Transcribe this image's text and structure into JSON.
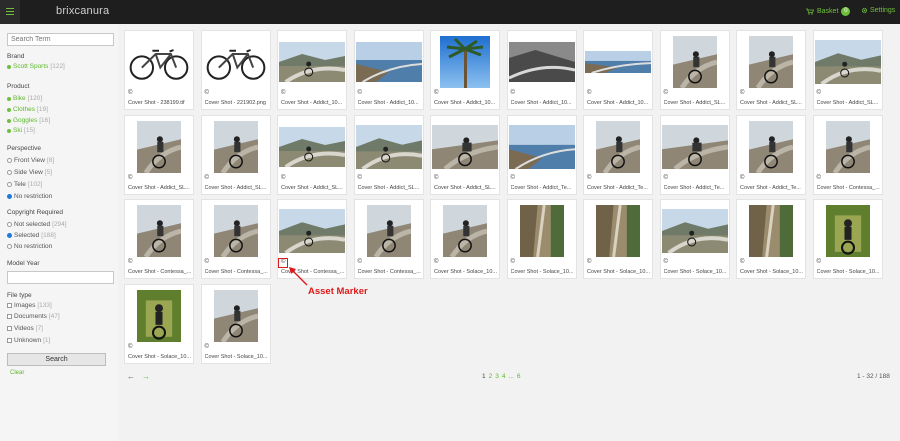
{
  "header": {
    "app_title": "brixcanura",
    "basket_label": "Basket",
    "basket_count": "0",
    "settings_label": "Settings"
  },
  "sidebar": {
    "search_placeholder": "Search Term",
    "brand_title": "Brand",
    "brand_items": [
      {
        "label": "Scott Sports",
        "count": "[122]"
      }
    ],
    "product_title": "Product",
    "product_items": [
      {
        "label": "Bike",
        "count": "[120]"
      },
      {
        "label": "Clothes",
        "count": "[19]"
      },
      {
        "label": "Goggles",
        "count": "[16]"
      },
      {
        "label": "Ski",
        "count": "[15]"
      }
    ],
    "perspective_title": "Perspective",
    "perspective_items": [
      {
        "label": "Front View",
        "count": "[8]",
        "selected": false
      },
      {
        "label": "Side View",
        "count": "[5]",
        "selected": false
      },
      {
        "label": "Tele",
        "count": "[102]",
        "selected": false
      },
      {
        "label": "No restriction",
        "count": "",
        "selected": true
      }
    ],
    "copyright_title": "Copyright Required",
    "copyright_items": [
      {
        "label": "Not selected",
        "count": "[294]",
        "selected": false
      },
      {
        "label": "Selected",
        "count": "[188]",
        "selected": true
      },
      {
        "label": "No restriction",
        "count": "",
        "selected": false
      }
    ],
    "model_year_title": "Model Year",
    "filetype_title": "File type",
    "filetype_items": [
      {
        "label": "Images",
        "count": "[133]"
      },
      {
        "label": "Documents",
        "count": "[47]"
      },
      {
        "label": "Videos",
        "count": "[7]"
      },
      {
        "label": "Unknown",
        "count": "[1]"
      }
    ],
    "search_button": "Search",
    "clear_link": "Clear"
  },
  "assets": [
    {
      "caption": "Cover Shot - 238199.tif",
      "kind": "bike",
      "w": 66,
      "h": 40
    },
    {
      "caption": "Cover Shot - 221902.png",
      "kind": "bike",
      "w": 66,
      "h": 40
    },
    {
      "caption": "Cover Shot - Addict_10...",
      "kind": "road",
      "w": 66,
      "h": 40
    },
    {
      "caption": "Cover Shot - Addict_10...",
      "kind": "sea",
      "w": 66,
      "h": 40
    },
    {
      "caption": "Cover Shot - Addict_10...",
      "kind": "palm",
      "w": 50,
      "h": 66
    },
    {
      "caption": "Cover Shot - Addict_10...",
      "kind": "bw",
      "w": 66,
      "h": 40
    },
    {
      "caption": "Cover Shot - Addict_10...",
      "kind": "sea",
      "w": 66,
      "h": 22
    },
    {
      "caption": "Cover Shot - Addict_SL...",
      "kind": "rider",
      "w": 44,
      "h": 66
    },
    {
      "caption": "Cover Shot - Addict_SL...",
      "kind": "rider",
      "w": 44,
      "h": 66
    },
    {
      "caption": "Cover Shot - Addict_SL...",
      "kind": "road",
      "w": 66,
      "h": 44
    },
    {
      "caption": "Cover Shot - Addict_SL...",
      "kind": "rider",
      "w": 44,
      "h": 66
    },
    {
      "caption": "Cover Shot - Addict_SL...",
      "kind": "rider",
      "w": 44,
      "h": 66
    },
    {
      "caption": "Cover Shot - Addict_SL...",
      "kind": "road",
      "w": 66,
      "h": 40
    },
    {
      "caption": "Cover Shot - Addict_SL...",
      "kind": "road",
      "w": 66,
      "h": 44
    },
    {
      "caption": "Cover Shot - Addict_SL...",
      "kind": "rider",
      "w": 66,
      "h": 44
    },
    {
      "caption": "Cover Shot - Addict_Te...",
      "kind": "sea",
      "w": 66,
      "h": 44
    },
    {
      "caption": "Cover Shot - Addict_Te...",
      "kind": "rider",
      "w": 44,
      "h": 66
    },
    {
      "caption": "Cover Shot - Addict_Te...",
      "kind": "rider",
      "w": 66,
      "h": 44
    },
    {
      "caption": "Cover Shot - Addict_Te...",
      "kind": "rider",
      "w": 44,
      "h": 66
    },
    {
      "caption": "Cover Shot - Contessa_...",
      "kind": "rider",
      "w": 44,
      "h": 66
    },
    {
      "caption": "Cover Shot - Contessa_...",
      "kind": "rider",
      "w": 44,
      "h": 66
    },
    {
      "caption": "Cover Shot - Contessa_...",
      "kind": "rider",
      "w": 44,
      "h": 66
    },
    {
      "caption": "Cover Shot - Contessa_...",
      "kind": "road",
      "w": 66,
      "h": 44
    },
    {
      "caption": "Cover Shot - Contessa_...",
      "kind": "rider",
      "w": 44,
      "h": 66
    },
    {
      "caption": "Cover Shot - Solace_10...",
      "kind": "rider",
      "w": 44,
      "h": 66
    },
    {
      "caption": "Cover Shot - Solace_10...",
      "kind": "cliff",
      "w": 44,
      "h": 66
    },
    {
      "caption": "Cover Shot - Solace_10...",
      "kind": "cliff",
      "w": 44,
      "h": 66
    },
    {
      "caption": "Cover Shot - Solace_10...",
      "kind": "road",
      "w": 66,
      "h": 44
    },
    {
      "caption": "Cover Shot - Solace_10...",
      "kind": "cliff",
      "w": 44,
      "h": 66
    },
    {
      "caption": "Cover Shot - Solace_10...",
      "kind": "green",
      "w": 44,
      "h": 66
    },
    {
      "caption": "Cover Shot - Solace_10...",
      "kind": "green",
      "w": 44,
      "h": 66
    },
    {
      "caption": "Cover Shot - Solace_10...",
      "kind": "rider",
      "w": 44,
      "h": 66
    }
  ],
  "annotation": {
    "label": "Asset Marker",
    "color": "#e01a1a"
  },
  "pager": {
    "prev": "←",
    "next": "→",
    "pages": [
      "1",
      "2",
      "3",
      "4",
      "...",
      "6"
    ],
    "current": "1",
    "range": "1 - 32 / 188"
  },
  "colors": {
    "accent": "#6fc03b",
    "topbar": "#1e1e1e"
  }
}
